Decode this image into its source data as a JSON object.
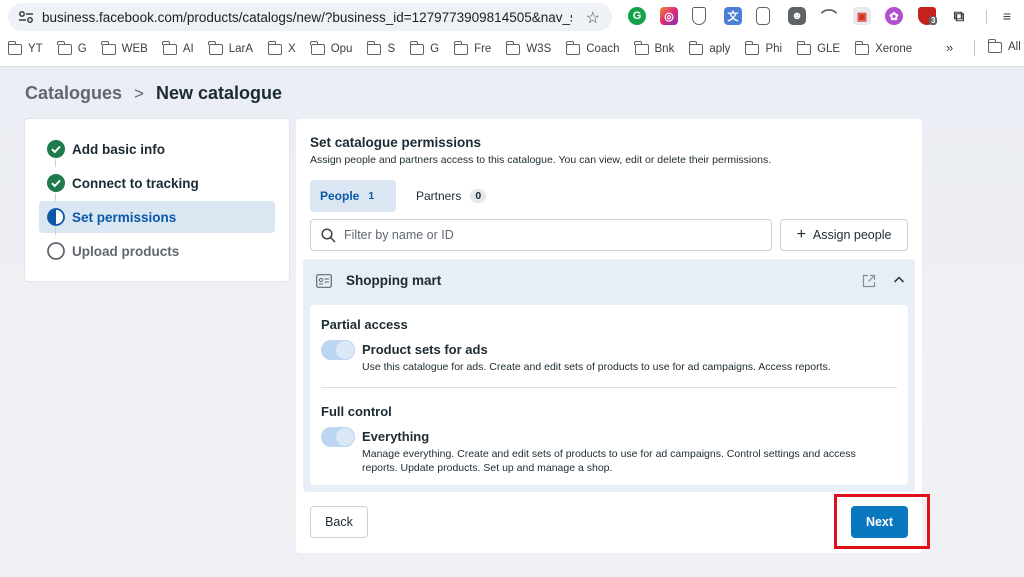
{
  "browser": {
    "url": "business.facebook.com/products/catalogs/new/?business_id=1279773909814505&nav_source...",
    "bookmarks": [
      "YT",
      "G",
      "WEB",
      "AI",
      "LarA",
      "X",
      "Opu",
      "S",
      "G",
      "Fre",
      "W3S",
      "Coach",
      "Bnk",
      "aply",
      "Phi",
      "GLE",
      "Xerone"
    ],
    "overflow": "»",
    "all_bookmarks": "All",
    "ext_badge": "3"
  },
  "breadcrumb": {
    "parent": "Catalogues",
    "separator": ">",
    "current": "New catalogue"
  },
  "steps": [
    {
      "label": "Add basic info",
      "status": "done"
    },
    {
      "label": "Connect to tracking",
      "status": "done"
    },
    {
      "label": "Set permissions",
      "status": "active"
    },
    {
      "label": "Upload products",
      "status": "pending"
    }
  ],
  "permissions": {
    "title": "Set catalogue permissions",
    "subtitle": "Assign people and partners access to this catalogue. You can view, edit or delete their permissions.",
    "tabs": [
      {
        "label": "People",
        "count": "1"
      },
      {
        "label": "Partners",
        "count": "0"
      }
    ],
    "search_placeholder": "Filter by name or ID",
    "assign_label": "Assign people"
  },
  "account": {
    "name": "Shopping mart",
    "sections": [
      {
        "heading": "Partial access",
        "title": "Product sets for ads",
        "description": "Use this catalogue for ads. Create and edit sets of products to use for ad campaigns. Access reports.",
        "enabled": true
      },
      {
        "heading": "Full control",
        "title": "Everything",
        "description": "Manage everything. Create and edit sets of products to use for ad campaigns. Control settings and access reports. Update products. Set up and manage a shop.",
        "enabled": true
      }
    ]
  },
  "footer": {
    "back_label": "Back",
    "next_label": "Next"
  },
  "colors": {
    "accent": "#0a78be",
    "done_green": "#1f7a4c",
    "active_blue": "#0a58a8",
    "highlight_red": "#e0101b"
  }
}
